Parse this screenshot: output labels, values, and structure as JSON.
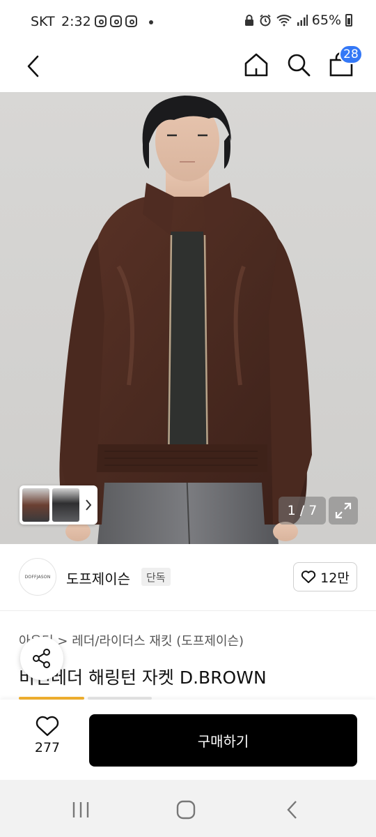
{
  "status_bar": {
    "carrier": "SKT",
    "time": "2:32",
    "battery": "65%"
  },
  "header": {
    "back_icon": "chevron-left-icon",
    "home_icon": "home-icon",
    "search_icon": "search-icon",
    "cart_icon": "shopping-bag-icon",
    "cart_count": "28"
  },
  "gallery": {
    "counter": "1 / 7",
    "current": 1,
    "total": 7
  },
  "brand": {
    "logo_text": "DOFFJASON",
    "name": "도프제이슨",
    "tag": "단독",
    "likes": "12만"
  },
  "product": {
    "breadcrumb_root": "아우터",
    "breadcrumb_sep": ">",
    "breadcrumb_category": "레더/라이더스 재킷 (도프제이슨)",
    "title": "비건레더 해링턴 자켓 D.BROWN"
  },
  "actions": {
    "wish_count": "277",
    "buy_label": "구매하기"
  },
  "colors": {
    "badge_blue": "#3478f6",
    "buy_button": "#000000",
    "accent_yellow": "#f3b230"
  }
}
